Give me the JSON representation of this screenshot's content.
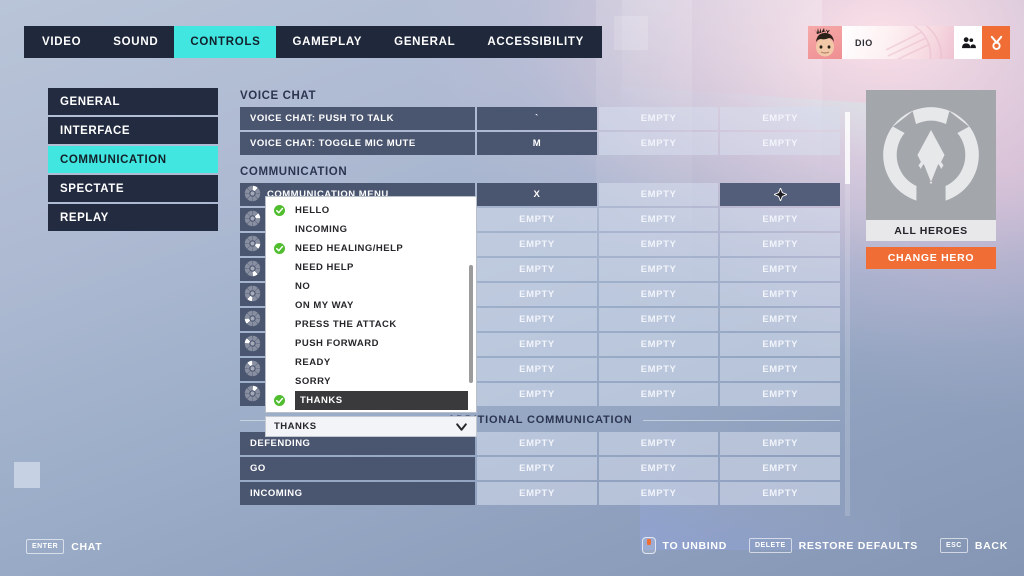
{
  "theme": {
    "accent_cyan": "#41e6e0",
    "accent_orange": "#f06e35",
    "panel_dark": "#20283c",
    "row_dark": "#4a5570",
    "row_light": "#d6deee"
  },
  "tabs": [
    {
      "label": "VIDEO",
      "active": false
    },
    {
      "label": "SOUND",
      "active": false
    },
    {
      "label": "CONTROLS",
      "active": true
    },
    {
      "label": "GAMEPLAY",
      "active": false
    },
    {
      "label": "GENERAL",
      "active": false
    },
    {
      "label": "ACCESSIBILITY",
      "active": false
    }
  ],
  "player_card": {
    "name": "DIO",
    "avatar_icon": "player-avatar-icon",
    "button_1_icon": "group-icon",
    "button_2_icon": "medal-icon"
  },
  "sidebar": {
    "items": [
      {
        "label": "GENERAL",
        "active": false
      },
      {
        "label": "INTERFACE",
        "active": false
      },
      {
        "label": "COMMUNICATION",
        "active": true
      },
      {
        "label": "SPECTATE",
        "active": false
      },
      {
        "label": "REPLAY",
        "active": false
      }
    ]
  },
  "hero_panel": {
    "logo_icon": "overwatch-logo-icon",
    "hero_name": "ALL HEROES",
    "change_hero_label": "CHANGE HERO"
  },
  "sections": {
    "voice_chat": {
      "title": "VOICE CHAT",
      "rows": [
        {
          "label": "VOICE CHAT: PUSH TO TALK",
          "binds": [
            "`",
            "EMPTY",
            "EMPTY"
          ],
          "bind_states": [
            "filled",
            "empty",
            "empty"
          ]
        },
        {
          "label": "VOICE CHAT: TOGGLE MIC MUTE",
          "binds": [
            "M",
            "EMPTY",
            "EMPTY"
          ],
          "bind_states": [
            "filled",
            "empty",
            "empty"
          ]
        }
      ]
    },
    "communication": {
      "title": "COMMUNICATION",
      "rows": [
        {
          "label": "COMMUNICATION MENU",
          "icon": "wheel-icon-0",
          "binds": [
            "X",
            "EMPTY",
            ""
          ],
          "bind_states": [
            "filled",
            "empty",
            "hovered"
          ]
        },
        {
          "label": "",
          "icon": "wheel-icon-1",
          "binds": [
            "EMPTY",
            "EMPTY",
            "EMPTY"
          ],
          "bind_states": [
            "empty",
            "empty",
            "empty"
          ]
        },
        {
          "label": "",
          "icon": "wheel-icon-2",
          "binds": [
            "EMPTY",
            "EMPTY",
            "EMPTY"
          ],
          "bind_states": [
            "empty",
            "empty",
            "empty"
          ]
        },
        {
          "label": "",
          "icon": "wheel-icon-3",
          "binds": [
            "EMPTY",
            "EMPTY",
            "EMPTY"
          ],
          "bind_states": [
            "empty",
            "empty",
            "empty"
          ]
        },
        {
          "label": "",
          "icon": "wheel-icon-4",
          "binds": [
            "EMPTY",
            "EMPTY",
            "EMPTY"
          ],
          "bind_states": [
            "empty",
            "empty",
            "empty"
          ]
        },
        {
          "label": "",
          "icon": "wheel-icon-5",
          "binds": [
            "EMPTY",
            "EMPTY",
            "EMPTY"
          ],
          "bind_states": [
            "empty",
            "empty",
            "empty"
          ]
        },
        {
          "label": "",
          "icon": "wheel-icon-6",
          "binds": [
            "EMPTY",
            "EMPTY",
            "EMPTY"
          ],
          "bind_states": [
            "empty",
            "empty",
            "empty"
          ]
        },
        {
          "label": "",
          "icon": "wheel-icon-7",
          "binds": [
            "EMPTY",
            "EMPTY",
            "EMPTY"
          ],
          "bind_states": [
            "empty",
            "empty",
            "empty"
          ]
        },
        {
          "label": "",
          "icon": "wheel-icon-8",
          "binds": [
            "EMPTY",
            "EMPTY",
            "EMPTY"
          ],
          "bind_states": [
            "empty",
            "empty",
            "empty"
          ]
        }
      ]
    },
    "additional_communication": {
      "title": "ADDITIONAL COMMUNICATION",
      "rows": [
        {
          "label": "DEFENDING",
          "binds": [
            "EMPTY",
            "EMPTY",
            "EMPTY"
          ],
          "bind_states": [
            "empty",
            "empty",
            "empty"
          ]
        },
        {
          "label": "GO",
          "binds": [
            "EMPTY",
            "EMPTY",
            "EMPTY"
          ],
          "bind_states": [
            "empty",
            "empty",
            "empty"
          ]
        },
        {
          "label": "INCOMING",
          "binds": [
            "EMPTY",
            "EMPTY",
            "EMPTY"
          ],
          "bind_states": [
            "empty",
            "empty",
            "empty"
          ]
        }
      ]
    }
  },
  "dropdown": {
    "open": true,
    "selected_value": "THANKS",
    "chevron_icon": "chevron-down-icon",
    "options": [
      {
        "label": "HELLO",
        "checked": true,
        "selected": false
      },
      {
        "label": "INCOMING",
        "checked": false,
        "selected": false
      },
      {
        "label": "NEED HEALING/HELP",
        "checked": true,
        "selected": false
      },
      {
        "label": "NEED HELP",
        "checked": false,
        "selected": false
      },
      {
        "label": "NO",
        "checked": false,
        "selected": false
      },
      {
        "label": "ON MY WAY",
        "checked": false,
        "selected": false
      },
      {
        "label": "PRESS THE ATTACK",
        "checked": false,
        "selected": false
      },
      {
        "label": "PUSH FORWARD",
        "checked": false,
        "selected": false
      },
      {
        "label": "READY",
        "checked": false,
        "selected": false
      },
      {
        "label": "SORRY",
        "checked": false,
        "selected": false
      },
      {
        "label": "THANKS",
        "checked": true,
        "selected": true
      }
    ]
  },
  "footer": {
    "left": {
      "key": "ENTER",
      "label": "CHAT"
    },
    "right": [
      {
        "key_icon": "mouse-button-icon",
        "key": "",
        "label": "TO UNBIND"
      },
      {
        "key_icon": "",
        "key": "DELETE",
        "label": "RESTORE DEFAULTS"
      },
      {
        "key_icon": "",
        "key": "ESC",
        "label": "BACK"
      }
    ]
  }
}
